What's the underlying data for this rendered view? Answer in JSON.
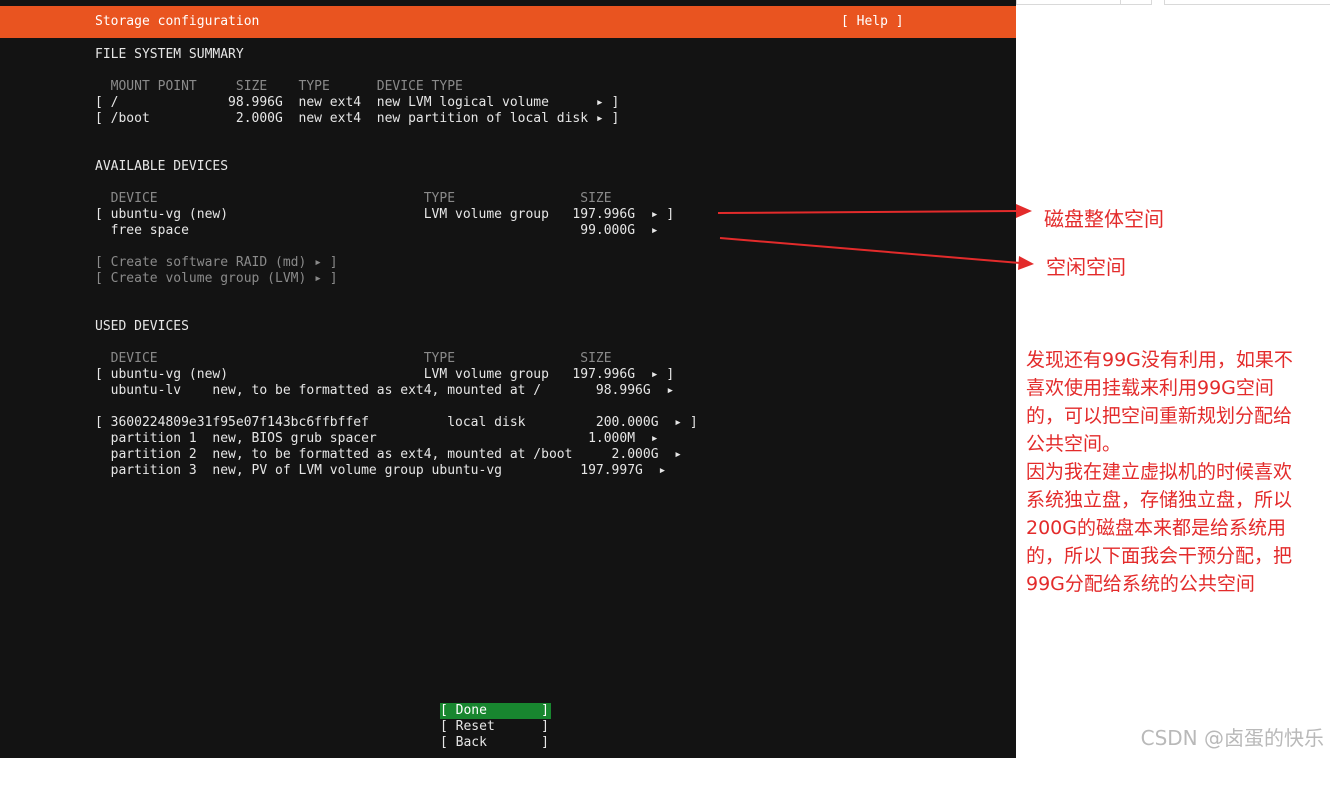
{
  "header": {
    "title": "Storage configuration",
    "help": "[ Help ]"
  },
  "fs_summary": {
    "heading": "FILE SYSTEM SUMMARY",
    "columns": "  MOUNT POINT     SIZE    TYPE      DEVICE TYPE",
    "rows": [
      "[ /              98.996G  new ext4  new LVM logical volume      ▸ ]",
      "[ /boot           2.000G  new ext4  new partition of local disk ▸ ]"
    ]
  },
  "available": {
    "heading": "AVAILABLE DEVICES",
    "columns": "  DEVICE                                  TYPE                SIZE",
    "rows": [
      "[ ubuntu-vg (new)                         LVM volume group   197.996G  ▸ ]",
      "  free space                                                  99.000G  ▸"
    ],
    "actions": [
      "[ Create software RAID (md) ▸ ]",
      "[ Create volume group (LVM) ▸ ]"
    ]
  },
  "used": {
    "heading": "USED DEVICES",
    "columns": "  DEVICE                                  TYPE                SIZE",
    "rows": [
      "[ ubuntu-vg (new)                         LVM volume group   197.996G  ▸ ]",
      "  ubuntu-lv    new, to be formatted as ext4, mounted at /       98.996G  ▸",
      "[ 3600224809e31f95e07f143bc6ffbffef          local disk         200.000G  ▸ ]",
      "  partition 1  new, BIOS grub spacer                           1.000M  ▸",
      "  partition 2  new, to be formatted as ext4, mounted at /boot     2.000G  ▸",
      "  partition 3  new, PV of LVM volume group ubuntu-vg          197.997G  ▸"
    ]
  },
  "buttons": [
    {
      "label": "[ Done",
      "close": "]",
      "selected": true
    },
    {
      "label": "[ Reset",
      "close": "]",
      "selected": false
    },
    {
      "label": "[ Back",
      "close": "]",
      "selected": false
    }
  ],
  "annotations": {
    "whole_space": "磁盘整体空间",
    "free_space": "空闲空间",
    "note_lines": [
      "发现还有99G没有利用，如果不",
      "喜欢使用挂载来利用99G空间",
      "的，可以把空间重新规划分配给",
      "公共空间。",
      "因为我在建立虚拟机的时候喜欢",
      "系统独立盘，存储独立盘，所以",
      "200G的磁盘本来都是给系统用",
      "的，所以下面我会干预分配，把",
      "99G分配给系统的公共空间"
    ]
  },
  "watermark": "CSDN @卤蛋的快乐",
  "colors": {
    "accent": "#e95420",
    "terminal_bg": "#131313",
    "selected_button": "#18862f",
    "annotation": "#e32b2b"
  }
}
